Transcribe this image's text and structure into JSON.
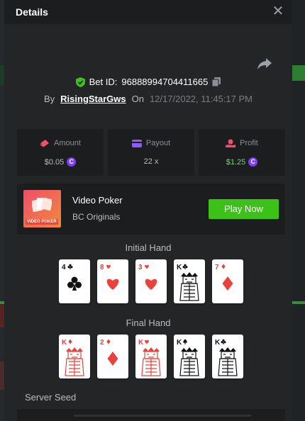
{
  "dialog": {
    "title": "Details"
  },
  "bet": {
    "id_label": "Bet ID:",
    "id_value": "96888994704411665"
  },
  "meta": {
    "by_label": "By",
    "username": "RisingStarGws",
    "on_label": "On",
    "datetime": "12/17/2022, 11:45:17 PM"
  },
  "stats": [
    {
      "label": "Amount",
      "value": "$0.05",
      "icon": "money-stack-icon",
      "color": "#f0506e"
    },
    {
      "label": "Payout",
      "value": "22 x",
      "icon": "wallet-icon",
      "color": "#8b5cf6"
    },
    {
      "label": "Profit",
      "value": "$1.25",
      "icon": "hand-coin-icon",
      "color": "#f0506e",
      "value_color": "#5ee060"
    }
  ],
  "game": {
    "name": "Video Poker",
    "provider": "BC Originals",
    "play_label": "Play Now",
    "thumb_text": "VIDEO POKER"
  },
  "initial_hand": {
    "label": "Initial Hand",
    "cards": [
      {
        "rank": "4",
        "suit": "clubs"
      },
      {
        "rank": "8",
        "suit": "hearts"
      },
      {
        "rank": "3",
        "suit": "hearts"
      },
      {
        "rank": "K",
        "suit": "clubs"
      },
      {
        "rank": "7",
        "suit": "diamonds"
      }
    ]
  },
  "final_hand": {
    "label": "Final Hand",
    "cards": [
      {
        "rank": "K",
        "suit": "diamonds"
      },
      {
        "rank": "2",
        "suit": "diamonds"
      },
      {
        "rank": "K",
        "suit": "hearts"
      },
      {
        "rank": "K",
        "suit": "spades"
      },
      {
        "rank": "K",
        "suit": "clubs"
      }
    ]
  },
  "server_seed": {
    "label": "Server Seed"
  },
  "colors": {
    "accent_green": "#3bc117",
    "coin_purple": "#7a3ff0",
    "red_suit": "#e8423c",
    "black_suit": "#111111"
  }
}
